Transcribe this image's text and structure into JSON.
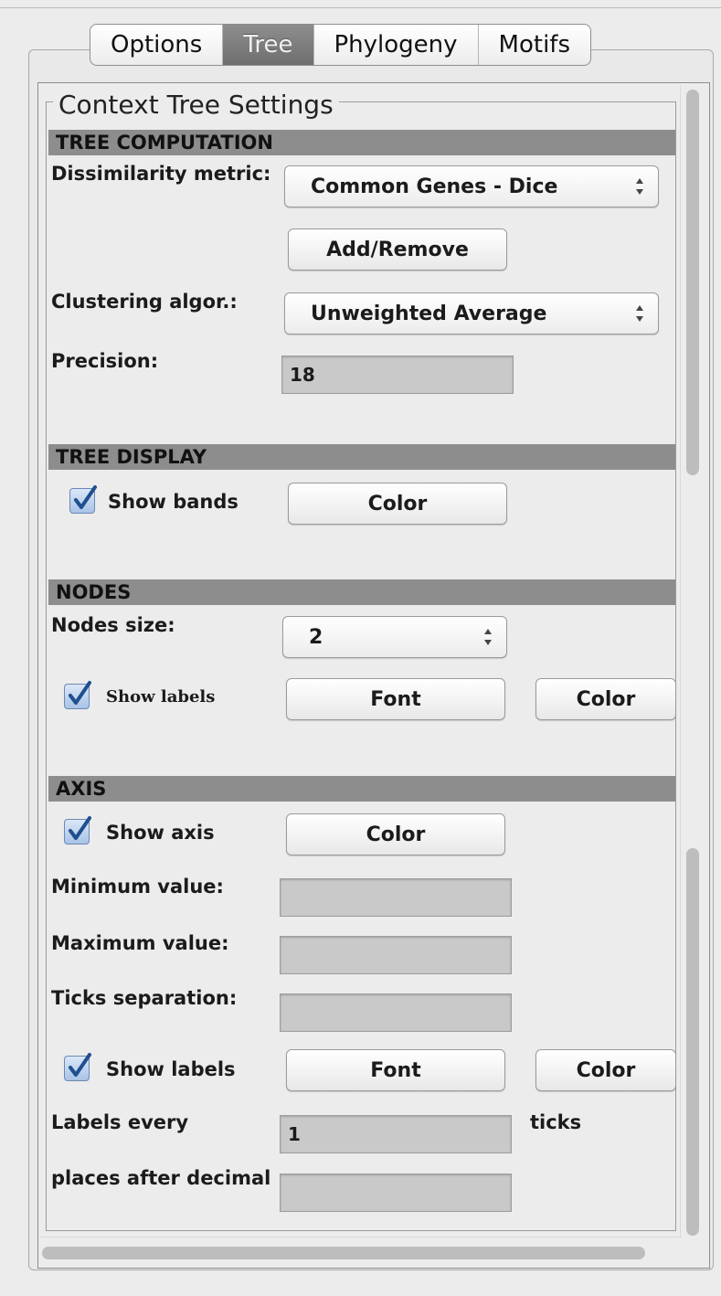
{
  "tabs": [
    {
      "label": "Options",
      "active": false
    },
    {
      "label": "Tree",
      "active": true
    },
    {
      "label": "Phylogeny",
      "active": false
    },
    {
      "label": "Motifs",
      "active": false
    }
  ],
  "group_title": "Context Tree Settings",
  "tree_computation": {
    "header": "TREE COMPUTATION",
    "dissimilarity_label": "Dissimilarity metric:",
    "dissimilarity_value": "Common Genes - Dice",
    "add_remove_label": "Add/Remove",
    "clustering_label": "Clustering algor.:",
    "clustering_value": "Unweighted Average",
    "precision_label": "Precision:",
    "precision_value": "18"
  },
  "tree_display": {
    "header": "TREE DISPLAY",
    "show_bands_label": "Show bands",
    "show_bands_checked": true,
    "color_label": "Color"
  },
  "nodes": {
    "header": "NODES",
    "size_label": "Nodes size:",
    "size_value": "2",
    "show_labels_label": "Show labels",
    "show_labels_checked": true,
    "font_label": "Font",
    "color_label": "Color"
  },
  "axis": {
    "header": "AXIS",
    "show_axis_label": "Show axis",
    "show_axis_checked": true,
    "color_label": "Color",
    "min_label": "Minimum value:",
    "min_value": "",
    "max_label": "Maximum value:",
    "max_value": "",
    "ticks_sep_label": "Ticks separation:",
    "ticks_sep_value": "",
    "show_labels_label": "Show labels",
    "show_labels_checked": true,
    "font_label": "Font",
    "labels_color_label": "Color",
    "labels_every_label": "Labels every",
    "labels_every_value": "1",
    "ticks_suffix": "ticks",
    "decimal_label": "places after decimal",
    "decimal_value": ""
  },
  "colors": {
    "section_header_bg": "#8d8d8d",
    "active_tab_bg": "#7a7a7a",
    "checkbox_fill": "#a9c3e6",
    "checkmark": "#1f4f8f"
  }
}
